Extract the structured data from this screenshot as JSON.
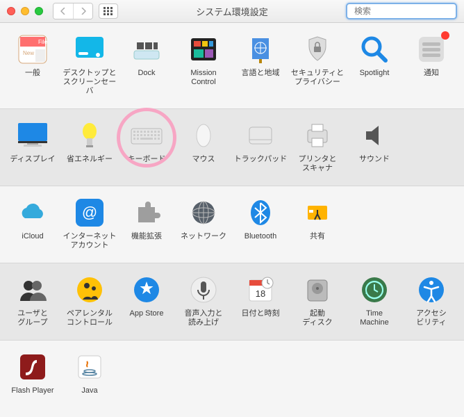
{
  "window": {
    "title": "システム環境設定",
    "search_placeholder": "検索"
  },
  "rows": [
    [
      {
        "name": "general",
        "label": "一般"
      },
      {
        "name": "desktop",
        "label": "デスクトップと\nスクリーンセーバ"
      },
      {
        "name": "dock",
        "label": "Dock"
      },
      {
        "name": "mission",
        "label": "Mission\nControl"
      },
      {
        "name": "language",
        "label": "言語と地域"
      },
      {
        "name": "security",
        "label": "セキュリティと\nプライバシー"
      },
      {
        "name": "spotlight",
        "label": "Spotlight"
      },
      {
        "name": "notifications",
        "label": "通知"
      }
    ],
    [
      {
        "name": "displays",
        "label": "ディスプレイ"
      },
      {
        "name": "energy",
        "label": "省エネルギー"
      },
      {
        "name": "keyboard",
        "label": "キーボード",
        "highlighted": true
      },
      {
        "name": "mouse",
        "label": "マウス"
      },
      {
        "name": "trackpad",
        "label": "トラックパッド"
      },
      {
        "name": "printers",
        "label": "プリンタと\nスキャナ"
      },
      {
        "name": "sound",
        "label": "サウンド"
      }
    ],
    [
      {
        "name": "icloud",
        "label": "iCloud"
      },
      {
        "name": "internet",
        "label": "インターネット\nアカウント"
      },
      {
        "name": "extensions",
        "label": "機能拡張"
      },
      {
        "name": "network",
        "label": "ネットワーク"
      },
      {
        "name": "bluetooth",
        "label": "Bluetooth"
      },
      {
        "name": "sharing",
        "label": "共有"
      }
    ],
    [
      {
        "name": "users",
        "label": "ユーザと\nグループ"
      },
      {
        "name": "parental",
        "label": "ペアレンタル\nコントロール"
      },
      {
        "name": "appstore",
        "label": "App Store"
      },
      {
        "name": "dictation",
        "label": "音声入力と\n読み上げ"
      },
      {
        "name": "date",
        "label": "日付と時刻"
      },
      {
        "name": "startup",
        "label": "起動\nディスク"
      },
      {
        "name": "timemachine",
        "label": "Time\nMachine"
      },
      {
        "name": "accessibility",
        "label": "アクセシ\nビリティ"
      }
    ],
    [
      {
        "name": "flash",
        "label": "Flash Player"
      },
      {
        "name": "java",
        "label": "Java"
      }
    ]
  ]
}
